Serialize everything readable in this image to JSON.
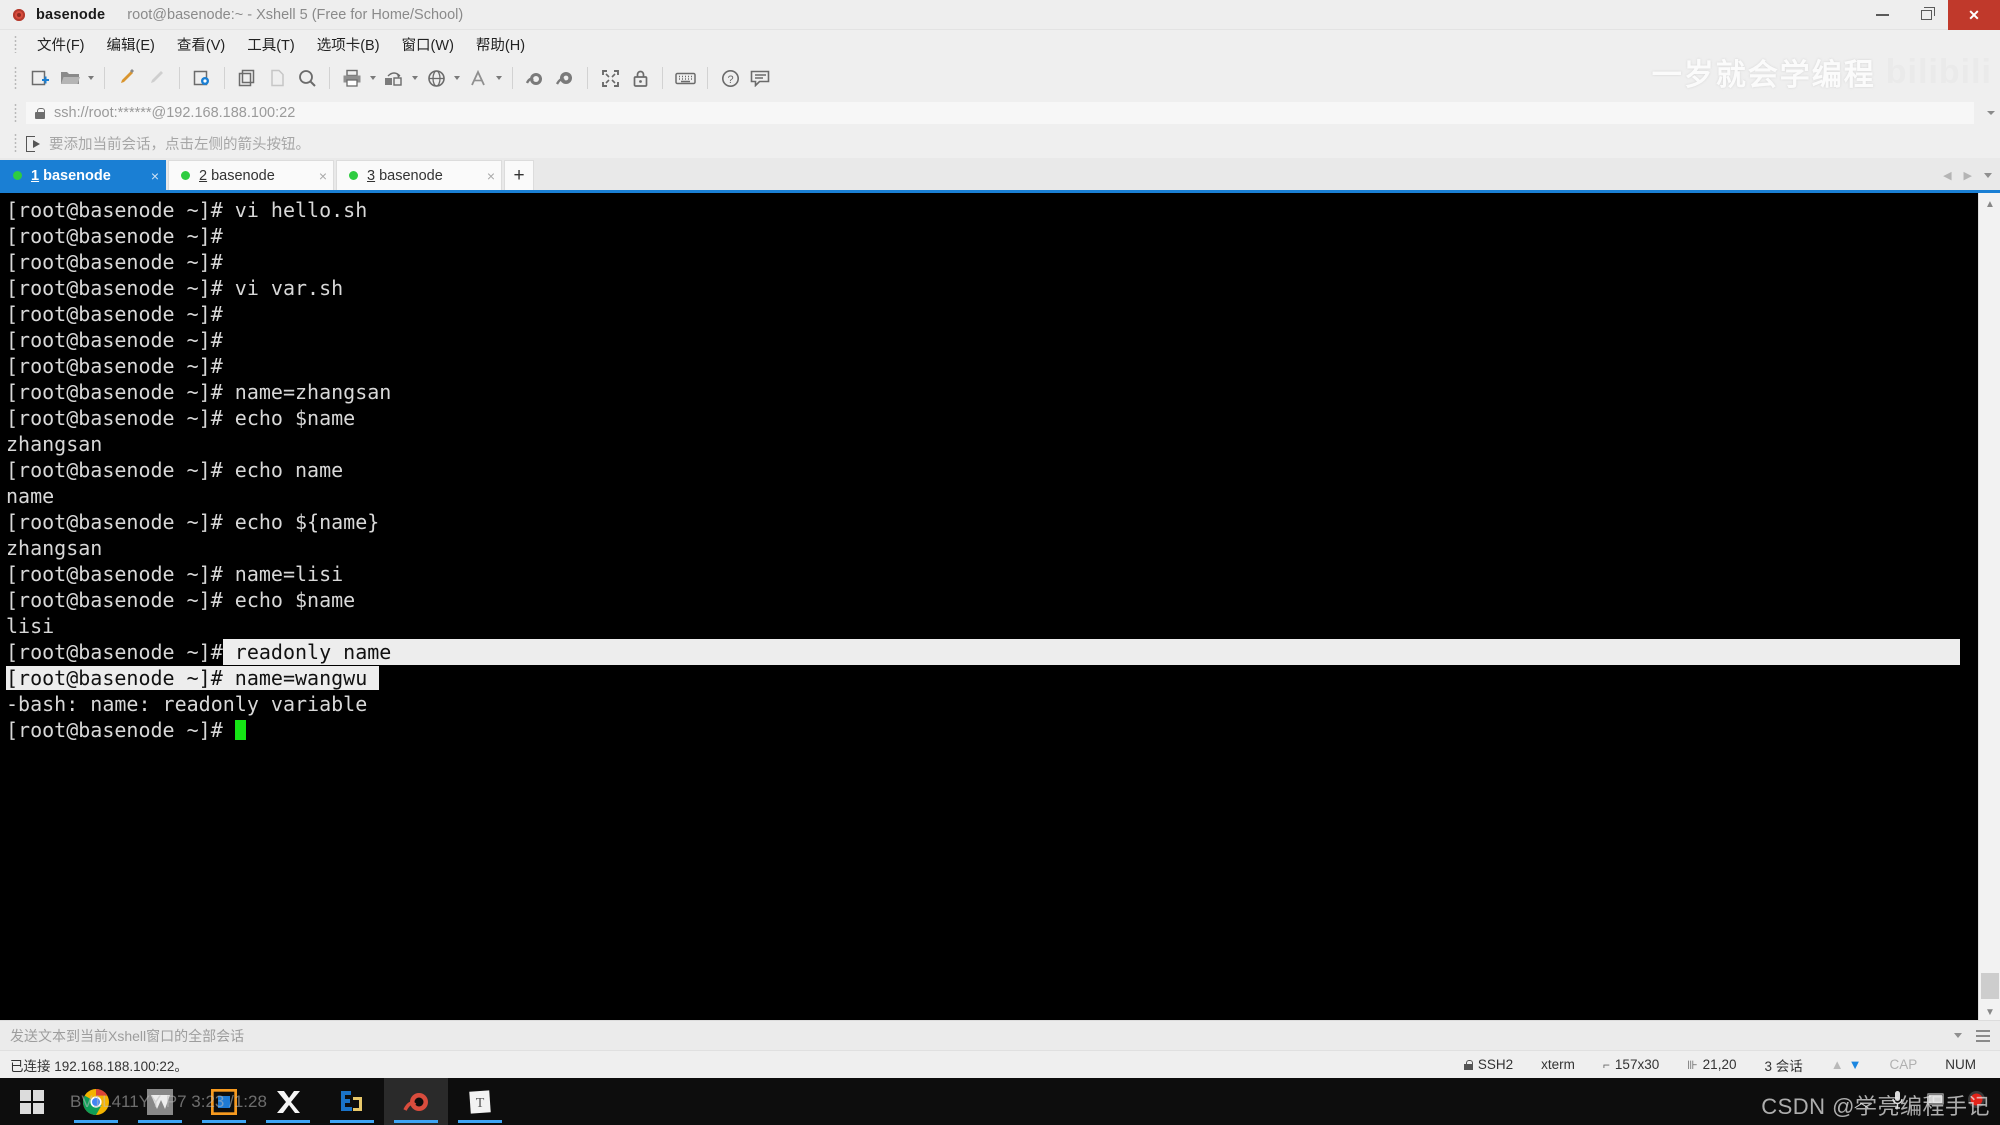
{
  "window": {
    "app_name": "basenode",
    "session_title": "root@basenode:~ - Xshell 5 (Free for Home/School)",
    "app_icon": "snail-icon",
    "minimize_label": "—",
    "restore_label": "❐",
    "close_label": "✕"
  },
  "menubar": {
    "items": [
      {
        "label": "文件(F)"
      },
      {
        "label": "编辑(E)"
      },
      {
        "label": "查看(V)"
      },
      {
        "label": "工具(T)"
      },
      {
        "label": "选项卡(B)"
      },
      {
        "label": "窗口(W)"
      },
      {
        "label": "帮助(H)"
      }
    ]
  },
  "toolbar": {
    "icons": [
      "new-session-icon",
      "open-folder-icon",
      "highlighter-icon",
      "pencil-icon",
      "session-properties-icon",
      "copy-session-icon",
      "paste-icon",
      "find-icon",
      "print-icon",
      "transfer-file-icon",
      "globe-icon",
      "font-icon",
      "snail-icon",
      "snail-alt-icon",
      "fullscreen-icon",
      "lock-icon",
      "keyboard-icon",
      "help-icon",
      "comment-icon"
    ]
  },
  "watermark": {
    "top_text": "一岁就会学编程",
    "top_logo": "bilibili",
    "bottom_text": "CSDN @学亮编程手记"
  },
  "address": {
    "lock_icon": "lock-icon",
    "value": "ssh://root:******@192.168.188.100:22",
    "dropdown_icon": "chevron-down-icon"
  },
  "hint": {
    "icon": "add-session-icon",
    "text": "要添加当前会话，点击左侧的箭头按钮。"
  },
  "tabs": {
    "items": [
      {
        "num": "1",
        "label": " basenode",
        "active": true,
        "dot_color": "#2ecc40",
        "close_label": "×"
      },
      {
        "num": "2",
        "label": " basenode",
        "active": false,
        "dot_color": "#2ecc40",
        "close_label": "×"
      },
      {
        "num": "3",
        "label": " basenode",
        "active": false,
        "dot_color": "#2ecc40",
        "close_label": "×"
      }
    ],
    "add_label": "+",
    "scroll_left": "◀",
    "scroll_right": "▶",
    "list_icon": "chevron-down-icon"
  },
  "terminal": {
    "prompt": "[root@basenode ~]# ",
    "lines": [
      {
        "text": "[root@basenode ~]# vi hello.sh"
      },
      {
        "text": "[root@basenode ~]#"
      },
      {
        "text": "[root@basenode ~]#"
      },
      {
        "text": "[root@basenode ~]# vi var.sh"
      },
      {
        "text": "[root@basenode ~]#"
      },
      {
        "text": "[root@basenode ~]#"
      },
      {
        "text": "[root@basenode ~]#"
      },
      {
        "text": "[root@basenode ~]# name=zhangsan"
      },
      {
        "text": "[root@basenode ~]# echo $name"
      },
      {
        "text": "zhangsan"
      },
      {
        "text": "[root@basenode ~]# echo name"
      },
      {
        "text": "name"
      },
      {
        "text": "[root@basenode ~]# echo ${name}"
      },
      {
        "text": "zhangsan"
      },
      {
        "text": "[root@basenode ~]# name=lisi"
      },
      {
        "text": "[root@basenode ~]# echo $name"
      },
      {
        "text": "lisi"
      },
      {
        "text": "[root@basenode ~]# readonly name",
        "selection": "tail",
        "unselected_prefix": "[root@basenode ~]#"
      },
      {
        "text": "[root@basenode ~]# name=wangwu",
        "selection": "head"
      },
      {
        "text": "-bash: name: readonly variable"
      },
      {
        "text": "[root@basenode ~]# ",
        "cursor": true
      }
    ],
    "selection_bg": "#ededed",
    "background": "#000000",
    "foreground": "#d8d8d8",
    "cursor_color": "#15e615"
  },
  "sendbar": {
    "placeholder": "发送文本到当前Xshell窗口的全部会话",
    "dropdown_icon": "chevron-down-icon",
    "menu_icon": "hamburger-icon"
  },
  "statusbar": {
    "connection": "已连接 192.168.188.100:22。",
    "protocol": "SSH2",
    "terminal_type": "xterm",
    "dimensions": "157x30",
    "cursor_pos": "21,20",
    "sessions": "3 会话",
    "upload_icon": "arrow-up-icon",
    "download_icon": "arrow-down-icon",
    "caps": "CAP",
    "num": "NUM"
  },
  "taskbar": {
    "overlay_text": "BV1L411YY P7 3:23 /1:28",
    "items": [
      {
        "name": "start-button",
        "color": "#ffffff"
      },
      {
        "name": "chrome-icon",
        "color": "#4285f4"
      },
      {
        "name": "vmware-icon",
        "color": "#7f7f7f"
      },
      {
        "name": "virtualbox-icon",
        "color": "#f79a1f"
      },
      {
        "name": "xmind-icon",
        "color": "#ffffff"
      },
      {
        "name": "editplus-icon",
        "color": "#1a73c8"
      },
      {
        "name": "xshell-icon",
        "color": "#d94c3d"
      },
      {
        "name": "typora-icon",
        "color": "#f2f2f2"
      }
    ],
    "tray": [
      "chevron-up-icon",
      "microphone-icon",
      "display-icon",
      "record-icon"
    ]
  }
}
